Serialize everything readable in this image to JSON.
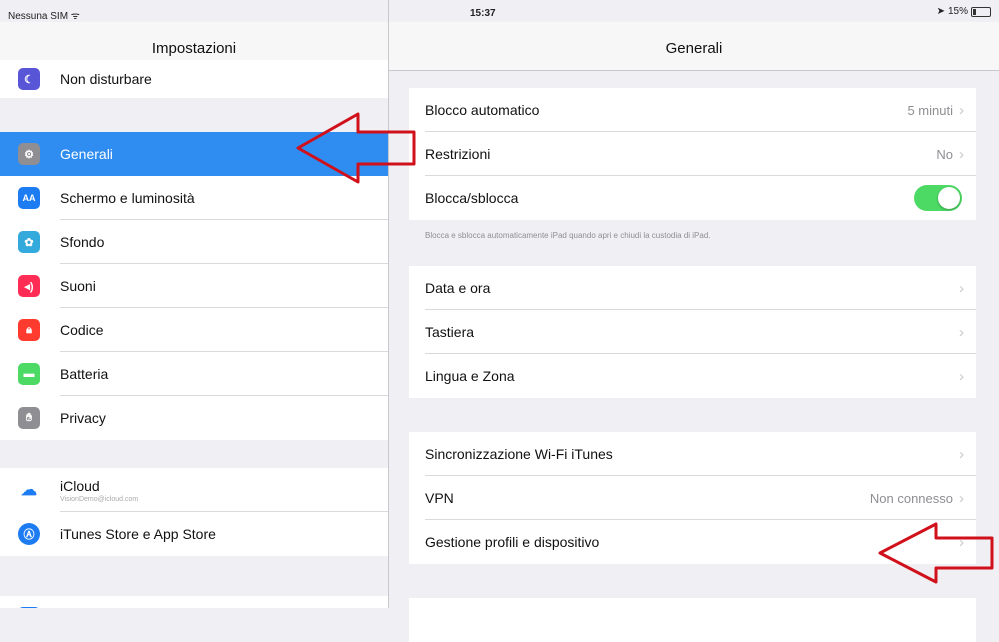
{
  "status_bar": {
    "carrier": "Nessuna SIM ᯤ",
    "time": "15:37",
    "battery": "15%",
    "location_icon": "location-arrow-icon"
  },
  "left": {
    "title": "Impostazioni",
    "items": [
      {
        "label": "Non disturbare",
        "icon": "moon-icon",
        "color": "#5856d6"
      },
      {
        "label": "Generali",
        "icon": "gear-icon",
        "color": "#8e8e93",
        "selected": true
      },
      {
        "label": "Schermo e luminosità",
        "icon": "display-icon",
        "color": "#1e7cf2"
      },
      {
        "label": "Sfondo",
        "icon": "wallpaper-icon",
        "color": "#34aadc"
      },
      {
        "label": "Suoni",
        "icon": "speaker-icon",
        "color": "#ff2d55"
      },
      {
        "label": "Codice",
        "icon": "lock-icon",
        "color": "#ff3b30"
      },
      {
        "label": "Batteria",
        "icon": "battery-icon",
        "color": "#4cd964"
      },
      {
        "label": "Privacy",
        "icon": "hand-icon",
        "color": "#8e8e93"
      },
      {
        "label": "iCloud",
        "sub": "VisionDemo@icloud.com",
        "icon": "cloud-icon",
        "color": "#ffffff"
      },
      {
        "label": "iTunes Store e App Store",
        "icon": "appstore-icon",
        "color": "#1e7cf2"
      }
    ]
  },
  "right": {
    "title": "Generali",
    "group1": [
      {
        "label": "Blocco automatico",
        "value": "5 minuti"
      },
      {
        "label": "Restrizioni",
        "value": "No"
      },
      {
        "label": "Blocca/sblocca",
        "toggle": true
      }
    ],
    "footnote": "Blocca e sblocca automaticamente iPad quando apri e chiudi la custodia di iPad.",
    "group2": [
      {
        "label": "Data e ora"
      },
      {
        "label": "Tastiera"
      },
      {
        "label": "Lingua e Zona"
      }
    ],
    "group3": [
      {
        "label": "Sincronizzazione Wi-Fi iTunes"
      },
      {
        "label": "VPN",
        "value": "Non connesso"
      },
      {
        "label": "Gestione profili e dispositivo"
      }
    ]
  },
  "colors": {
    "selection": "#2f8cf0",
    "toggle_on": "#4cd964",
    "annotation_arrow": "#d0101a"
  }
}
